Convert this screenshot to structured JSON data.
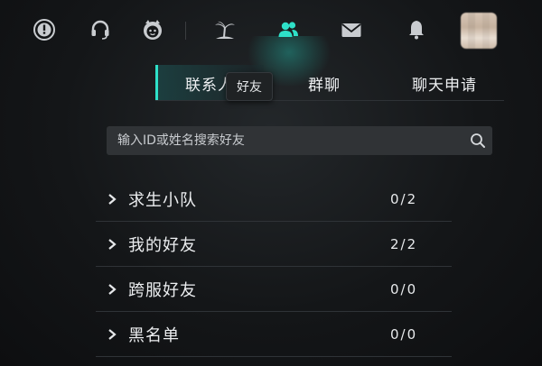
{
  "topbar": {
    "icons": [
      "alert-icon",
      "headset-icon",
      "mascot-icon",
      "island-icon",
      "friends-icon",
      "mail-icon",
      "bell-icon"
    ],
    "active_icon": "friends-icon",
    "accent": "#2ee0c8"
  },
  "tabs": [
    {
      "label": "联系人"
    },
    {
      "label": "群聊"
    },
    {
      "label": "聊天申请"
    }
  ],
  "tooltip": {
    "text": "好友"
  },
  "search": {
    "placeholder": "输入ID或姓名搜索好友"
  },
  "groups": [
    {
      "label": "求生小队",
      "count": "0/2"
    },
    {
      "label": "我的好友",
      "count": "2/2"
    },
    {
      "label": "跨服好友",
      "count": "0/0"
    },
    {
      "label": "黑名单",
      "count": "0/0"
    }
  ]
}
